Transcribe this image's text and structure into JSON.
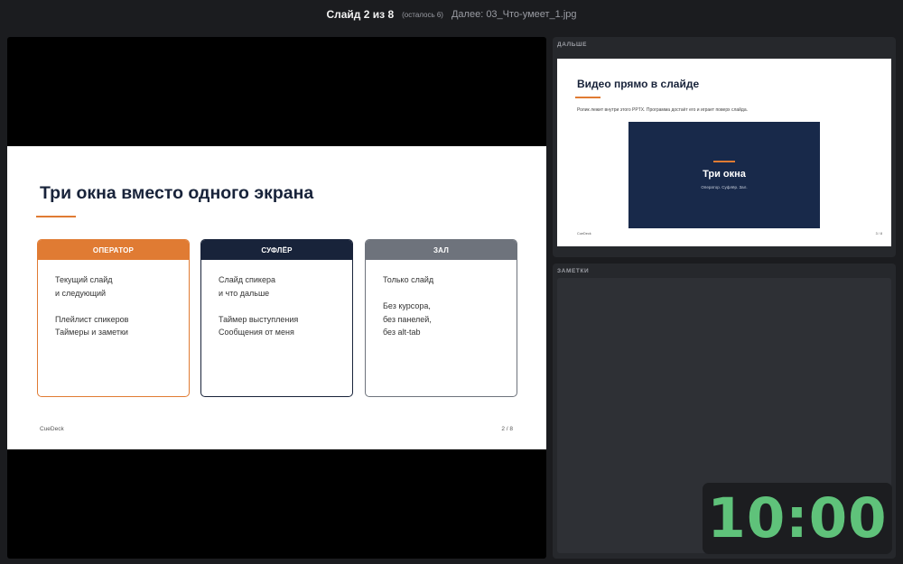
{
  "topbar": {
    "slide_position": "Слайд 2 из 8",
    "remaining": "(осталось 6)",
    "next_file": "Далее: 03_Что-умеет_1.jpg"
  },
  "current_slide": {
    "title": "Три окна вместо одного экрана",
    "cards": [
      {
        "header": "ОПЕРАТОР",
        "lines": [
          "Текущий слайд",
          "и следующий",
          "",
          "Плейлист спикеров",
          "Таймеры и заметки"
        ]
      },
      {
        "header": "СУФЛЁР",
        "lines": [
          "Слайд спикера",
          "и что дальше",
          "",
          "Таймер выступления",
          "Сообщения от меня"
        ]
      },
      {
        "header": "ЗАЛ",
        "lines": [
          "Только слайд",
          "",
          "Без курсора,",
          "без панелей,",
          "без alt-tab"
        ]
      }
    ],
    "footer_left": "CueDeck",
    "footer_right": "2 / 8"
  },
  "next_panel": {
    "label": "ДАЛЬШЕ",
    "slide": {
      "title": "Видео прямо в слайде",
      "subtitle": "Ролик лежит внутри этого PPTX. Программа достаёт его и играет поверх слайда.",
      "video_title": "Три окна",
      "video_subtitle": "Оператор. Суфлёр. Зал.",
      "footer_left": "CueDeck",
      "footer_right": "3 / 8"
    }
  },
  "notes_panel": {
    "label": "ЗАМЕТКИ"
  },
  "timer": {
    "value": "10:00",
    "color": "#5fc27a"
  },
  "colors": {
    "accent": "#e07b33",
    "navy": "#18233a",
    "gray": "#6e737c"
  }
}
